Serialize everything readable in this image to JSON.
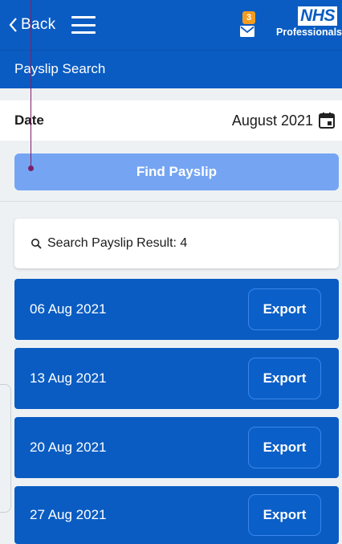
{
  "header": {
    "back_label": "Back",
    "mail_badge": "3",
    "logo_nhs": "NHS",
    "logo_professionals": "Professionals"
  },
  "subheader": {
    "title": "Payslip Search"
  },
  "search": {
    "date_label": "Date",
    "date_value": "August 2021",
    "find_button": "Find Payslip"
  },
  "result": {
    "summary": "Search Payslip Result: 4"
  },
  "payslips": [
    {
      "date": "06 Aug 2021",
      "action": "Export"
    },
    {
      "date": "13 Aug 2021",
      "action": "Export"
    },
    {
      "date": "20 Aug 2021",
      "action": "Export"
    },
    {
      "date": "27 Aug 2021",
      "action": "Export"
    }
  ],
  "icons": {
    "back": "chevron-left-icon",
    "menu": "hamburger-menu-icon",
    "mail": "mail-icon",
    "calendar": "calendar-icon",
    "search": "search-icon"
  },
  "colors": {
    "brand_blue": "#0a5cc2",
    "find_button": "#75a5f2",
    "badge": "#f39c1f",
    "background": "#eef1f4"
  }
}
